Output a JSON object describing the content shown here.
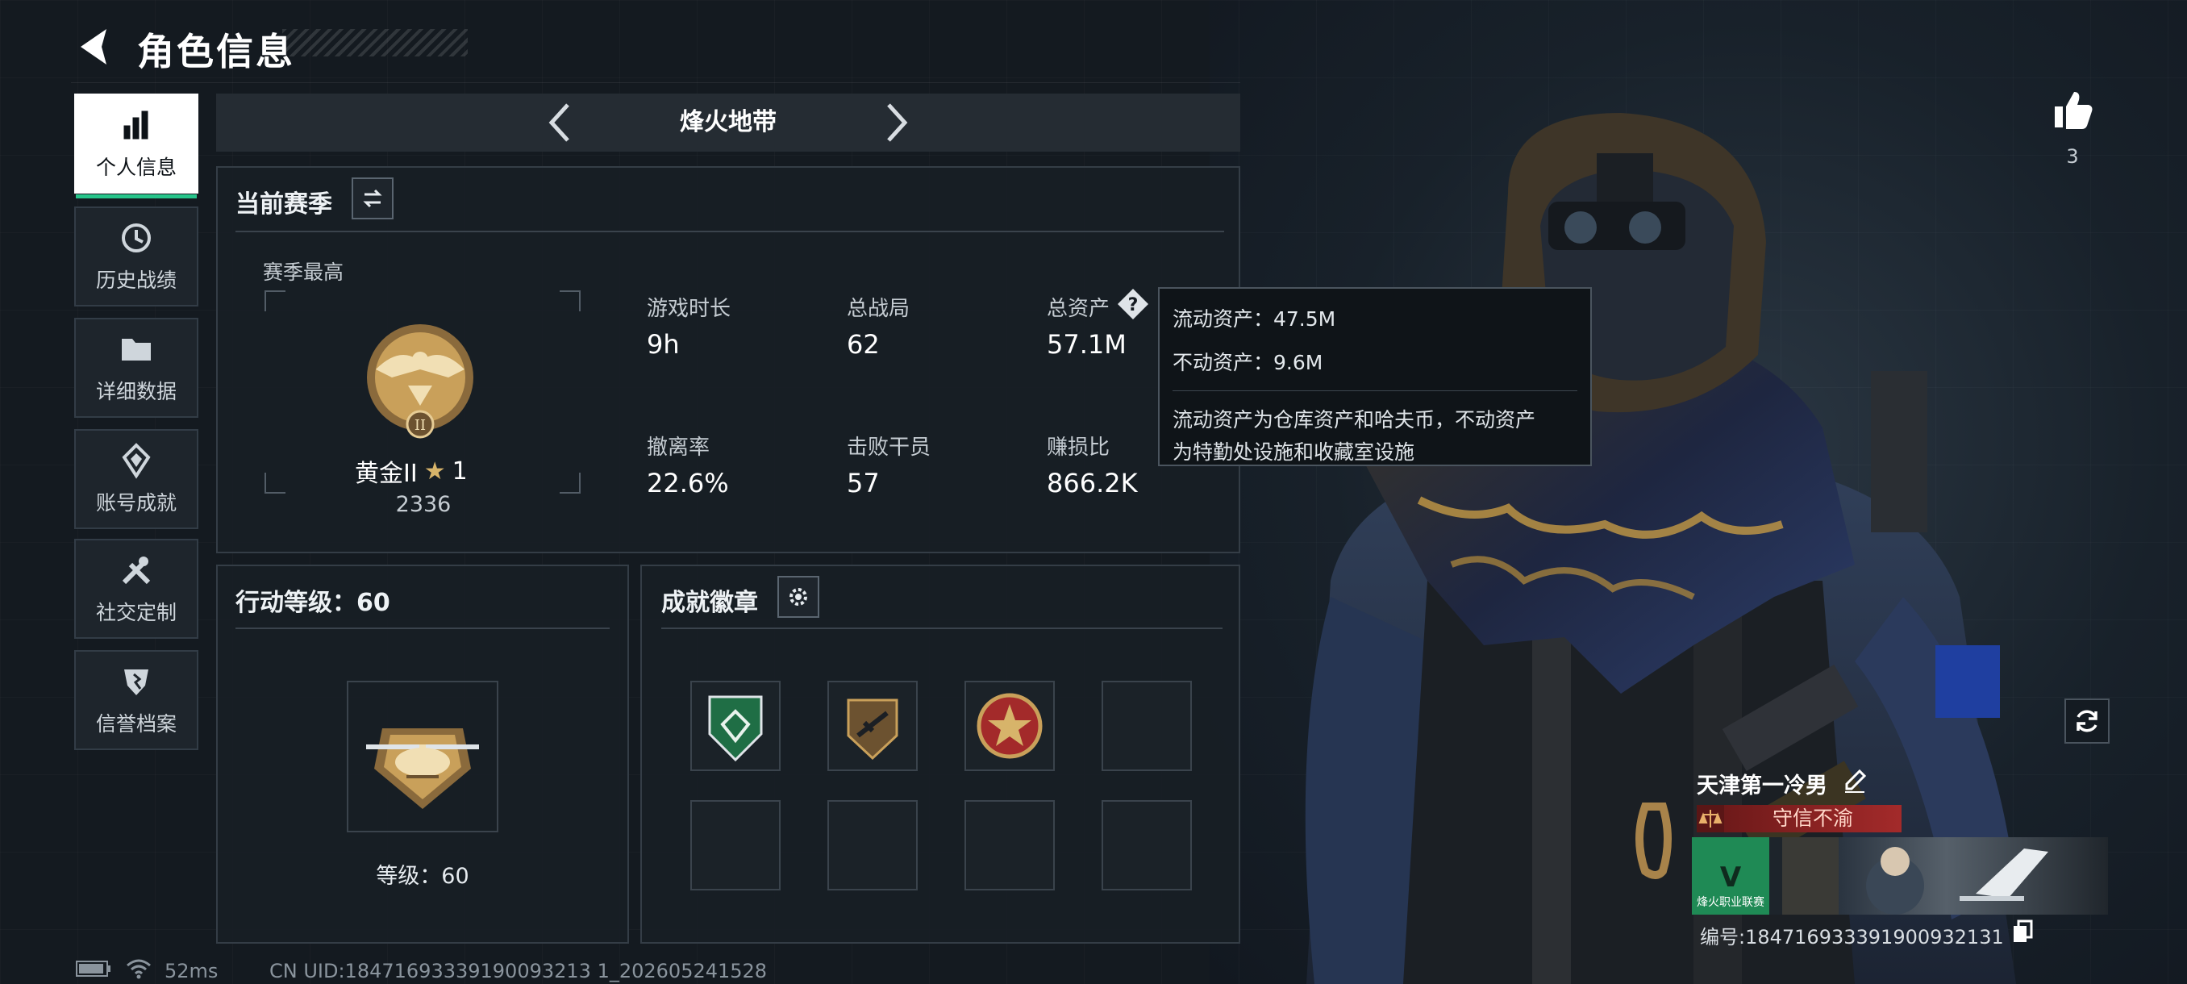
{
  "header": {
    "title": "角色信息"
  },
  "sidebar": {
    "items": [
      {
        "label": "个人信息",
        "icon": "bar-chart-icon",
        "active": true
      },
      {
        "label": "历史战绩",
        "icon": "history-icon",
        "active": false
      },
      {
        "label": "详细数据",
        "icon": "folder-icon",
        "active": false
      },
      {
        "label": "账号成就",
        "icon": "achievement-icon",
        "active": false
      },
      {
        "label": "社交定制",
        "icon": "tools-icon",
        "active": false
      },
      {
        "label": "信誉档案",
        "icon": "shield-icon",
        "active": false
      }
    ]
  },
  "mode_tabs": {
    "current": "烽火地带"
  },
  "season": {
    "title": "当前赛季",
    "best_label": "赛季最高",
    "rank_name": "黄金II",
    "rank_stars": "1",
    "rank_points": "2336",
    "stats": [
      {
        "label": "游戏时长",
        "value": "9h"
      },
      {
        "label": "总战局",
        "value": "62"
      },
      {
        "label": "总资产",
        "value": "57.1M"
      },
      {
        "label": "撤离率",
        "value": "22.6%"
      },
      {
        "label": "击败干员",
        "value": "57"
      },
      {
        "label": "赚损比",
        "value": "866.2K"
      }
    ]
  },
  "tooltip": {
    "liquid": "流动资产：47.5M",
    "fixed": "不动资产：9.6M",
    "explain_line1": "流动资产为仓库资产和哈夫币，不动资产",
    "explain_line2": "为特勤处设施和收藏室设施"
  },
  "action_level": {
    "title": "行动等级：60",
    "level_text": "等级：60"
  },
  "badges": {
    "title": "成就徽章"
  },
  "character": {
    "likes": "3",
    "name": "天津第一冷男",
    "trust_label": "守信不渝",
    "card_text": "烽火职业联赛",
    "uid": "编号:18471693339190093213​1"
  },
  "status": {
    "ping": "52ms",
    "uid_line": "CN UID:18471693339190093213 1_202605241528"
  },
  "colors": {
    "accent_green": "#27c48a",
    "trust_red": "#a32a2a",
    "gold": "#c9a05a"
  }
}
